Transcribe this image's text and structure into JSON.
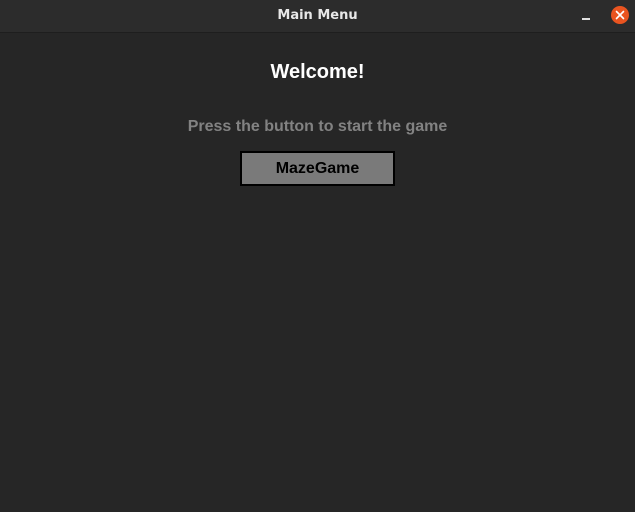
{
  "window": {
    "title": "Main Menu",
    "close_color": "#e95420",
    "icons": {
      "minimize": "minimize-icon",
      "close": "close-icon"
    }
  },
  "main": {
    "heading": "Welcome!",
    "instruction": "Press the button to start the game",
    "start_button_label": "MazeGame"
  },
  "colors": {
    "background": "#262626",
    "titlebar": "#2c2c2c",
    "button_fill": "#7a7a7a",
    "button_border": "#000000",
    "instruction_text": "#828282"
  }
}
